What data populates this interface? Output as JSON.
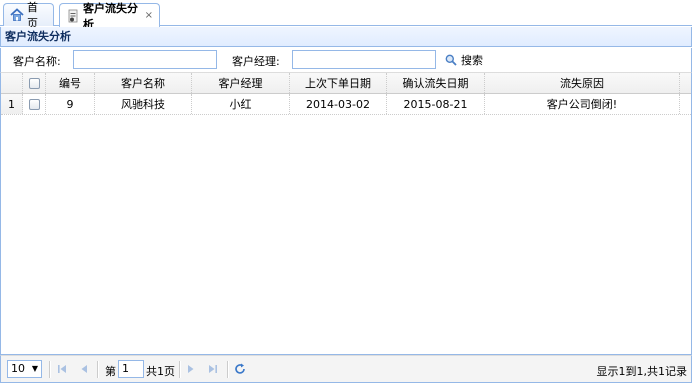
{
  "tabs": [
    {
      "label": "首页",
      "icon": "home-icon"
    },
    {
      "label": "客户流失分析",
      "icon": "document-icon",
      "close": "×"
    }
  ],
  "panel": {
    "title": "客户流失分析"
  },
  "search": {
    "name_label": "客户名称:",
    "name_value": "",
    "manager_label": "客户经理:",
    "manager_value": "",
    "button_label": "搜索"
  },
  "grid": {
    "columns": [
      "编号",
      "客户名称",
      "客户经理",
      "上次下单日期",
      "确认流失日期",
      "流失原因"
    ],
    "rows": [
      {
        "rownum": "1",
        "id": "9",
        "name": "风驰科技",
        "manager": "小红",
        "last_order": "2014-03-02",
        "confirm_date": "2015-08-21",
        "reason": "客户公司倒闭!"
      }
    ]
  },
  "pager": {
    "page_size": "10",
    "page_prefix": "第",
    "page_value": "1",
    "page_suffix": "共1页",
    "info": "显示1到1,共1记录"
  },
  "colors": {
    "border": "#95b8e7",
    "header_text": "#0e2d5f",
    "icon_blue": "#5a8fd8"
  }
}
